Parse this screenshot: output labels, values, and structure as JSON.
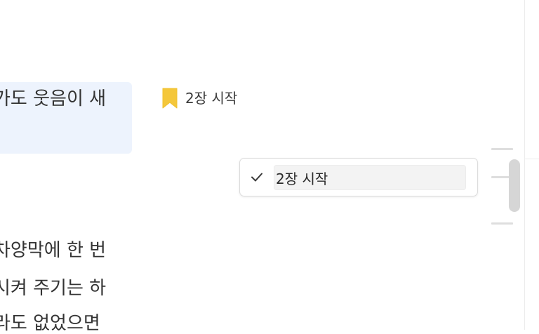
{
  "document": {
    "lines": [
      "가도 웃음이 새",
      "차양막에 한 번",
      "시켜 주기는 하",
      "라도 없었으면"
    ]
  },
  "bookmark": {
    "icon": "bookmark-icon",
    "label": "2장 시작",
    "color": "#f4c73b"
  },
  "edit_popover": {
    "confirm_icon": "check-icon",
    "input_value": "2장 시작"
  },
  "scrollbar": {
    "marks": 3
  }
}
